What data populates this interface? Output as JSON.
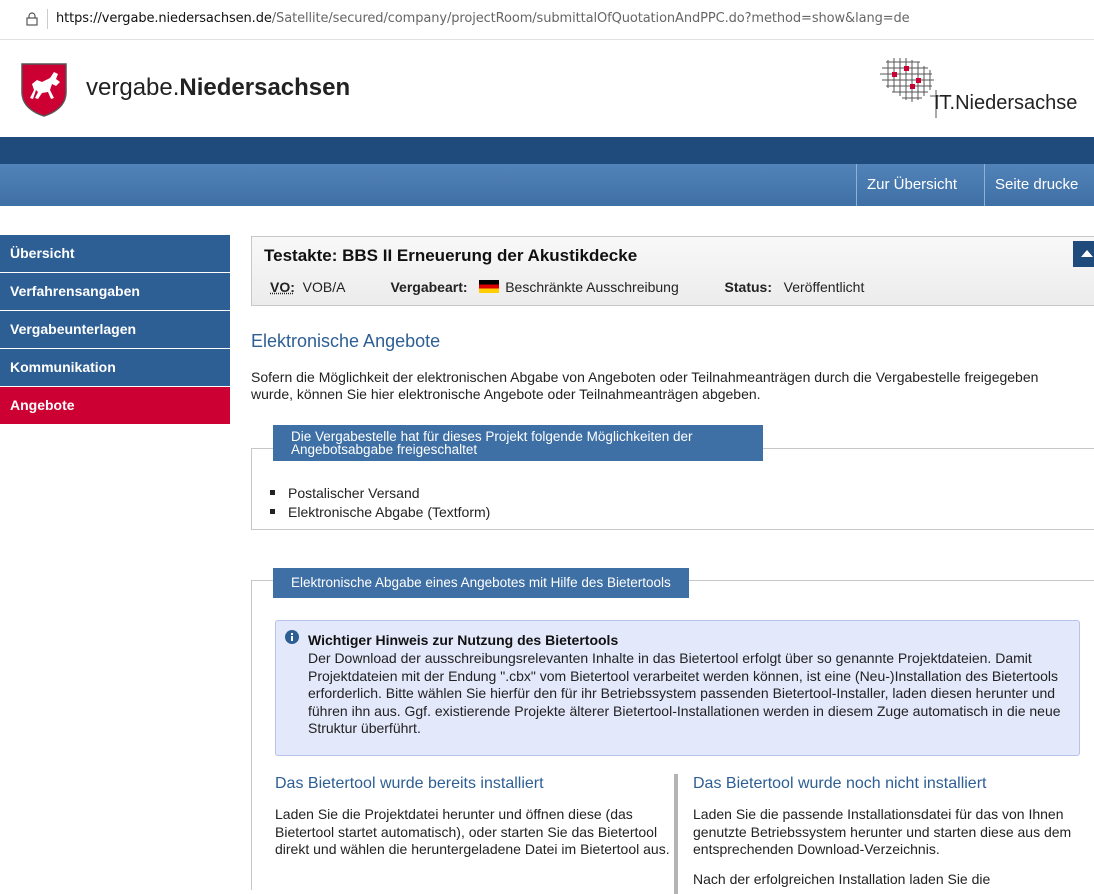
{
  "browser": {
    "url_host": "https://vergabe.niedersachsen.de",
    "url_path": "/Satellite/secured/company/projectRoom/submittalOfQuotationAndPPC.do?method=show&lang=de"
  },
  "header": {
    "brand_prefix": "vergabe.",
    "brand_bold": "Niedersachsen",
    "partner_logo_text": "IT.Niedersachse"
  },
  "nav": {
    "overview": "Zur Übersicht",
    "print": "Seite drucke"
  },
  "sidebar": {
    "items": [
      {
        "label": "Übersicht"
      },
      {
        "label": "Verfahrensangaben"
      },
      {
        "label": "Vergabeunterlagen"
      },
      {
        "label": "Kommunikation"
      },
      {
        "label": "Angebote"
      }
    ]
  },
  "project": {
    "title": "Testakte: BBS II Erneuerung der Akustikdecke",
    "vo_label": "VO:",
    "vo_value": "VOB/A",
    "type_label": "Vergabeart:",
    "type_value": "Beschränkte Ausschreibung",
    "status_label": "Status:",
    "status_value": "Veröffentlicht"
  },
  "main": {
    "section_title": "Elektronische Angebote",
    "intro": "Sofern die Möglichkeit der elektronischen Abgabe von Angeboten oder Teilnahmeanträgen durch die Vergabestelle freigegeben wurde, können Sie hier elektronische Angebote oder Teilnahmeanträgen abgeben.",
    "options_head_line1": "Die Vergabestelle hat für dieses Projekt folgende Möglichkeiten der",
    "options_head_line2": "Angebotsabgabe freigeschaltet",
    "options": [
      "Postalischer Versand",
      "Elektronische Abgabe (Textform)"
    ],
    "tool_head": "Elektronische Abgabe eines Angebotes mit Hilfe des Bietertools",
    "notice_title": "Wichtiger Hinweis zur Nutzung des Bietertools",
    "notice_body": "Der Download der ausschreibungsrelevanten Inhalte in das Bietertool erfolgt über so genannte Projektdateien. Damit Projektdateien mit der Endung \".cbx\" vom Bietertool verarbeitet werden können, ist eine (Neu-)Installation des Bietertools erforderlich. Bitte wählen Sie hierfür den für ihr Betriebssystem passenden Bietertool-Installer, laden diesen herunter und führen ihn aus. Ggf. existierende Projekte älterer Bietertool-Installationen werden in diesem Zuge automatisch in die neue Struktur überführt.",
    "installed_title": "Das Bietertool wurde bereits installiert",
    "installed_text": "Laden Sie die Projektdatei herunter und öffnen diese (das Bietertool startet automatisch), oder starten Sie das Bietertool direkt und wählen die heruntergeladene Datei im Bietertool aus.",
    "not_installed_title": "Das Bietertool wurde noch nicht installiert",
    "not_installed_text": "Laden Sie die passende Installationsdatei für das von Ihnen genutzte Betriebssystem herunter und starten diese aus dem entsprechenden Download-Verzeichnis.",
    "not_installed_text2": "Nach der erfolgreichen Installation laden Sie die"
  },
  "colors": {
    "primary_blue": "#2d5f94",
    "dark_blue": "#1e4a7c",
    "active_red": "#cc0033",
    "notice_bg": "#e3e8fb"
  }
}
